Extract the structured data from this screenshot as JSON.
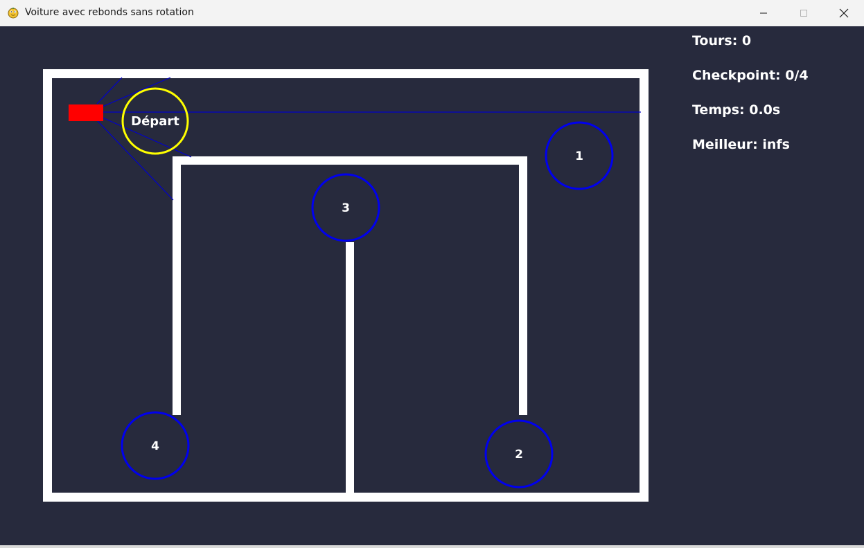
{
  "window": {
    "title": "Voiture avec rebonds sans rotation",
    "app_icon": "pygame-snake-icon",
    "controls": [
      "minimize-icon",
      "maximize-icon",
      "close-icon"
    ]
  },
  "hud": {
    "laps": "Tours: 0",
    "checkpoint": "Checkpoint: 0/4",
    "time": "Temps: 0.0s",
    "best": "Meilleur: infs"
  },
  "track": {
    "start_label": "Départ",
    "checkpoints": [
      {
        "label": "1"
      },
      {
        "label": "2"
      },
      {
        "label": "3"
      },
      {
        "label": "4"
      }
    ]
  },
  "colors": {
    "background": "#272a3d",
    "walls": "#ffffff",
    "car": "#ff0000",
    "sensor_rays": "#0000cc",
    "checkpoint_ring": "#0000ee",
    "start_ring": "#ffff00",
    "text": "#ffffff"
  }
}
